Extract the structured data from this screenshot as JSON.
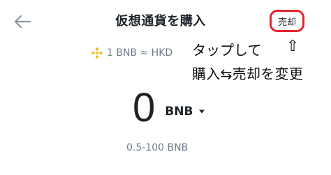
{
  "header": {
    "title": "仮想通貨を購入",
    "toggle_label": "売却"
  },
  "rate": {
    "text": "1 BNB ≈ HKD"
  },
  "annotation": {
    "line1": "タップして",
    "arrow": "⇧",
    "line2": "購入⇆売却を変更"
  },
  "amount": {
    "value": "0",
    "currency": "BNB"
  },
  "limits": {
    "text": "0.5-100 BNB"
  },
  "colors": {
    "accent_border": "#e3252f",
    "bnb_yellow": "#f0b90b",
    "text_primary": "#1e2329",
    "text_secondary": "#707a8a"
  },
  "icons": {
    "back": "back-arrow-icon",
    "coin": "bnb-icon",
    "dropdown": "caret-down-icon"
  }
}
